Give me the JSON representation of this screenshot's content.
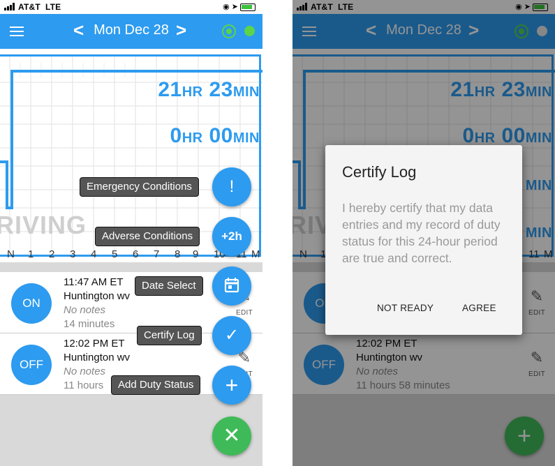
{
  "status": {
    "carrier": "AT&T",
    "network": "LTE"
  },
  "header": {
    "prev": "<",
    "date": "Mon Dec 28",
    "next": ">"
  },
  "graph": {
    "hours1": "21",
    "unit_hr": "HR",
    "min1": "23",
    "unit_min": "MIN",
    "hours2": "0",
    "min2": "00",
    "hours3": "0",
    "min3": "2",
    "hours4": "0",
    "min4": "1",
    "driving_label": "RIVING",
    "axis": [
      "N",
      "1",
      "2",
      "3",
      "4",
      "5",
      "6",
      "7",
      "8",
      "9",
      "10",
      "11",
      "M"
    ]
  },
  "rows": [
    {
      "status": "ON",
      "time": "11:47 AM ET",
      "place": "Huntington wv",
      "notes": "No notes",
      "duration": "14 minutes",
      "edit": "EDIT"
    },
    {
      "status": "OFF",
      "time": "12:02 PM ET",
      "place": "Huntington wv",
      "notes": "No notes",
      "duration": "11 hours 58 minutes",
      "edit": "EDIT"
    }
  ],
  "left_duration_visible": "11 hours",
  "fab_menu": {
    "emergency": {
      "label": "Emergency Conditions",
      "glyph": "!"
    },
    "adverse": {
      "label": "Adverse Conditions",
      "glyph": "+2h"
    },
    "date_select": {
      "label": "Date Select"
    },
    "certify": {
      "label": "Certify Log",
      "glyph": "✓"
    },
    "add_duty": {
      "label": "Add Duty Status",
      "glyph": "+"
    },
    "close": {
      "glyph": "✕"
    }
  },
  "dialog": {
    "title": "Certify Log",
    "body": "I hereby certify that my data entries and my record of duty status for this 24-hour period are true and correct.",
    "not_ready": "NOT READY",
    "agree": "AGREE"
  },
  "add_fab_glyph": "+",
  "colors": {
    "primary": "#2d9bef",
    "green": "#3fba58",
    "gps": "#5bd44a"
  }
}
